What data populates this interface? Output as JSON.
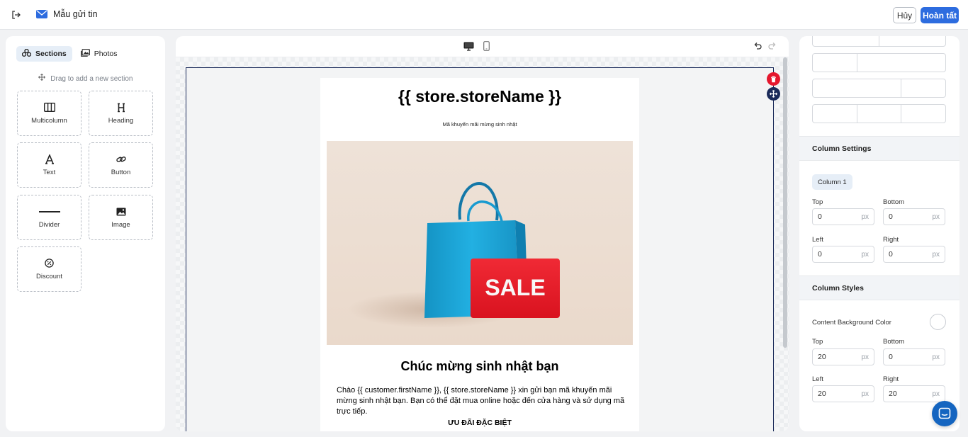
{
  "topbar": {
    "title": "Mẫu gửi tin",
    "cancel_label": "Hủy",
    "done_label": "Hoàn tất"
  },
  "left_panel": {
    "tabs": [
      {
        "label": "Sections",
        "icon": "sections-icon",
        "active": true
      },
      {
        "label": "Photos",
        "icon": "photos-icon",
        "active": false
      }
    ],
    "drag_hint": "Drag to add a new section",
    "blocks": [
      {
        "label": "Multicolumn",
        "icon": "columns-icon"
      },
      {
        "label": "Heading",
        "icon": "heading-icon"
      },
      {
        "label": "Text",
        "icon": "text-icon"
      },
      {
        "label": "Button",
        "icon": "link-icon"
      },
      {
        "label": "Divider",
        "icon": "divider-icon"
      },
      {
        "label": "Image",
        "icon": "image-icon"
      },
      {
        "label": "Discount",
        "icon": "discount-icon"
      }
    ]
  },
  "email": {
    "store_name": "{{ store.storeName }}",
    "subtitle": "Mã khuyến mãi mừng sinh nhật",
    "sale_text": "SALE",
    "heading": "Chúc mừng sinh nhật bạn",
    "body": "Chào {{ customer.firstName }}, {{ store.storeName }} xin gửi bạn mã khuyến mãi mừng sinh nhật bạn. Bạn có thể đặt mua online hoặc đến cửa hàng và sử dụng mã trực tiếp.",
    "promo_title": "ƯU ĐÃI ĐẶC BIỆT"
  },
  "right_panel": {
    "column_settings": {
      "title": "Column Settings",
      "chip": "Column 1",
      "top_label": "Top",
      "top_value": "0",
      "bottom_label": "Bottom",
      "bottom_value": "0",
      "left_label": "Left",
      "left_value": "0",
      "right_label": "Right",
      "right_value": "0",
      "unit": "px"
    },
    "column_styles": {
      "title": "Column Styles",
      "bg_label": "Content Background Color",
      "top_label": "Top",
      "top_value": "20",
      "bottom_label": "Bottom",
      "bottom_value": "0",
      "left_label": "Left",
      "left_value": "20",
      "right_label": "Right",
      "right_value": "20",
      "unit": "px"
    }
  },
  "colors": {
    "primary": "#2d6cdf",
    "danger": "#e5172e",
    "selection": "#1b2b5a",
    "bag": "#1aa6d8",
    "sale_tag": "#ea1f2b"
  }
}
